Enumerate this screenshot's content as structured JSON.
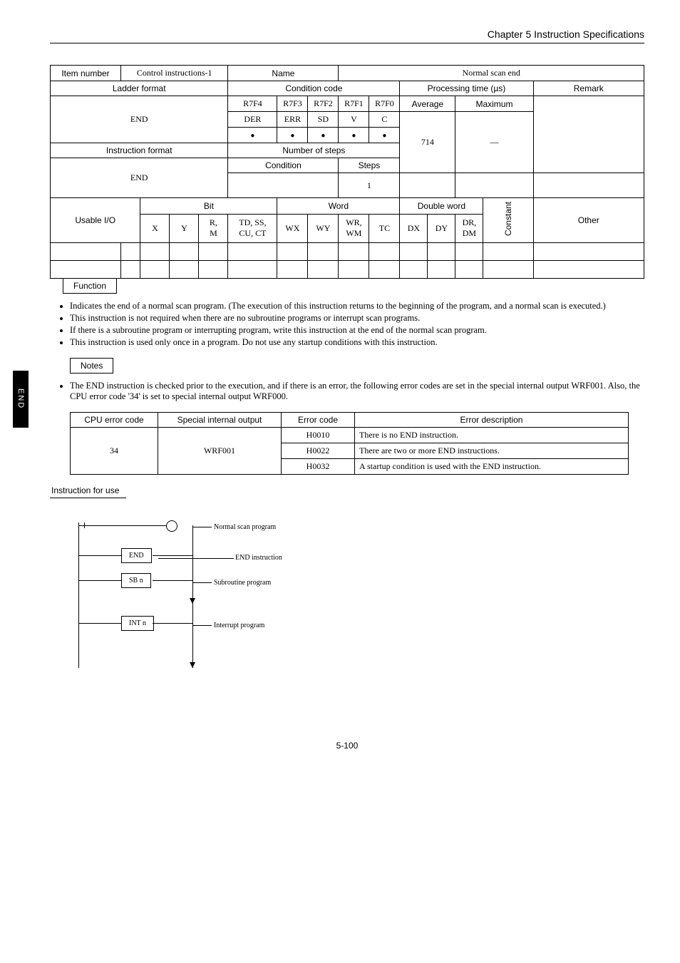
{
  "chapter_title": "Chapter 5  Instruction Specifications",
  "side_tab": "END",
  "hdr": {
    "item_number_label": "Item number",
    "item_number": "Control instructions-1",
    "name_label": "Name",
    "name": "Normal scan end",
    "ladder_format_label": "Ladder format",
    "ladder_format": "END",
    "condition_code_label": "Condition code",
    "processing_time_label": "Processing time (µs)",
    "remark_label": "Remark",
    "cols": {
      "r7f4": "R7F4",
      "r7f3": "R7F3",
      "r7f2": "R7F2",
      "r7f1": "R7F1",
      "r7f0": "R7F0",
      "avg": "Average",
      "max": "Maximum"
    },
    "cc_row": {
      "der": "DER",
      "err": "ERR",
      "sd": "SD",
      "v": "V",
      "c": "C"
    },
    "instr_format_label": "Instruction format",
    "instr_format": "END",
    "number_of_steps_label": "Number of steps",
    "num_steps": "714",
    "dash": "—",
    "condition_label": "Condition",
    "steps_label": "Steps",
    "steps": "1",
    "usable_label": "Usable I/O",
    "bit_label": "Bit",
    "word_label": "Word",
    "dword_label": "Double word",
    "constant_label": "Constant",
    "other_label": "Other",
    "io_cols": {
      "x": "X",
      "y": "Y",
      "rm": "R,\nM",
      "tdss": "TD, SS,\nCU, CT",
      "wx": "WX",
      "wy": "WY",
      "wrwm": "WR,\nWM",
      "tc": "TC",
      "dx": "DX",
      "dy": "DY",
      "drdm": "DR,\nDM"
    }
  },
  "function_label": "Function",
  "function_bullets": [
    "Indicates the end of a normal scan program.  (The execution of this instruction returns to the beginning of the program, and a normal scan is executed.)",
    "This instruction is not required when there are no subroutine programs or interrupt scan programs.",
    "If there is a subroutine program or interrupting program, write this instruction at the end of the normal scan program.",
    "This instruction is used only once in a program.  Do not use any startup conditions with this instruction."
  ],
  "notes_label": "Notes",
  "notes_bullets": [
    "The END instruction is checked prior to the execution, and if there is an error, the following error codes are set in the special internal output WRF001.  Also, the CPU error code '34' is set to special internal output WRF000."
  ],
  "err_table": {
    "h1": "CPU error code",
    "h2": "Special internal output",
    "h3": "Error code",
    "h4": "Error description",
    "cpu": "34",
    "sio": "WRF001",
    "rows": [
      {
        "code": "H0010",
        "desc": "There is no END instruction."
      },
      {
        "code": "H0022",
        "desc": "There are two or more END instructions."
      },
      {
        "code": "H0032",
        "desc": "A startup condition is used with the END instruction."
      }
    ]
  },
  "instr_use_label": "Instruction for use",
  "diagram": {
    "end": "END",
    "sbn": "SB n",
    "intn": "INT n",
    "label1": "Normal scan program",
    "label2": "END instruction",
    "label3": "Subroutine program",
    "label4": "Interrupt program"
  },
  "footer": "5-100"
}
